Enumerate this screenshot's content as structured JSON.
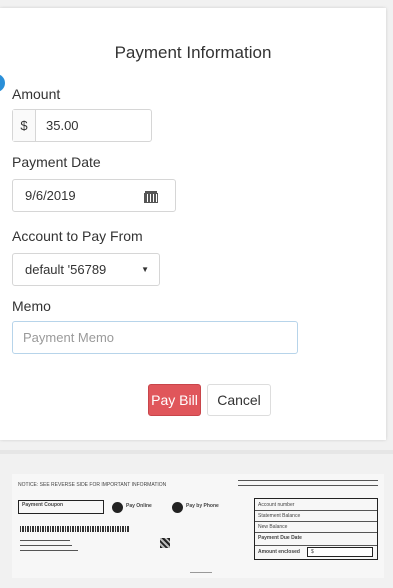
{
  "form": {
    "title": "Payment Information",
    "amount_label": "Amount",
    "currency_symbol": "$",
    "amount_value": "35.00",
    "date_label": "Payment Date",
    "date_value": "9/6/2019",
    "account_label": "Account to Pay From",
    "account_value": "default '56789",
    "memo_label": "Memo",
    "memo_placeholder": "Payment Memo",
    "pay_button": "Pay Bill",
    "cancel_button": "Cancel"
  },
  "bill": {
    "notice": "NOTICE: SEE REVERSE SIDE FOR IMPORTANT INFORMATION",
    "coupon_title": "Payment Coupon",
    "pay_online": "Pay Online",
    "pay_by_phone": "Pay by Phone",
    "summary_rows": [
      "Account number",
      "Statement Balance",
      "New Balance",
      "Payment Due Date",
      "Amount enclosed"
    ],
    "amount_enclosed_value": "$"
  },
  "colors": {
    "accent_blue": "#2a8fd8",
    "pay_button": "#e0565b"
  },
  "icons": {
    "date_picker": "calendar-icon",
    "dropdown": "caret-down-icon"
  }
}
